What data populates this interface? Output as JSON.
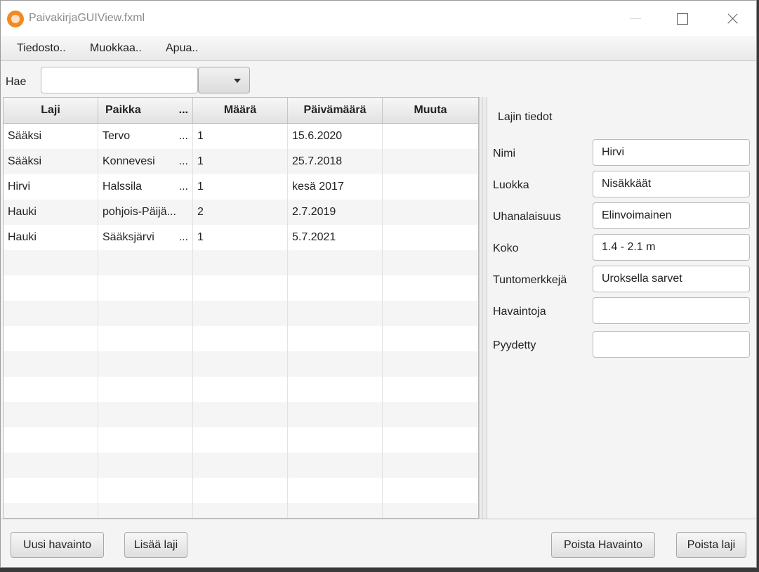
{
  "window": {
    "title": "PaivakirjaGUIView.fxml"
  },
  "menu": {
    "items": [
      "Tiedosto..",
      "Muokkaa..",
      "Apua.."
    ]
  },
  "search": {
    "label": "Hae",
    "value": ""
  },
  "table": {
    "columns": [
      "Laji",
      "Paikka",
      "Määrä",
      "Päivämäärä",
      "Muuta"
    ],
    "rows": [
      {
        "laji": "Sääksi",
        "paikka": "Tervo",
        "paikka_truncated": true,
        "maara": "1",
        "pvm": "15.6.2020",
        "muuta": ""
      },
      {
        "laji": "Sääksi",
        "paikka": "Konnevesi",
        "paikka_truncated": true,
        "maara": "1",
        "pvm": "25.7.2018",
        "muuta": ""
      },
      {
        "laji": "Hirvi",
        "paikka": "Halssila",
        "paikka_truncated": true,
        "maara": "1",
        "pvm": "kesä 2017",
        "muuta": ""
      },
      {
        "laji": "Hauki",
        "paikka": "pohjois-Päijä...",
        "paikka_truncated": false,
        "maara": "2",
        "pvm": "2.7.2019",
        "muuta": ""
      },
      {
        "laji": "Hauki",
        "paikka": "Sääksjärvi",
        "paikka_truncated": true,
        "maara": "1",
        "pvm": "5.7.2021",
        "muuta": ""
      }
    ],
    "empty_row_count": 11
  },
  "details": {
    "title": "Lajin tiedot",
    "fields": [
      {
        "label": "Nimi",
        "value": "Hirvi"
      },
      {
        "label": "Luokka",
        "value": "Nisäkkäät"
      },
      {
        "label": "Uhanalaisuus",
        "value": "Elinvoimainen"
      },
      {
        "label": "Koko",
        "value": "1.4 - 2.1 m"
      },
      {
        "label": "Tuntomerkkejä",
        "value": "Uroksella sarvet"
      },
      {
        "label": "Havaintoja",
        "value": ""
      },
      {
        "label": "Pyydetty",
        "value": ""
      }
    ]
  },
  "buttons": {
    "new_observation": "Uusi havainto",
    "add_species": "Lisää laji",
    "remove_observation": "Poista Havainto",
    "remove_species": "Poista laji"
  },
  "ellipsis": "..."
}
